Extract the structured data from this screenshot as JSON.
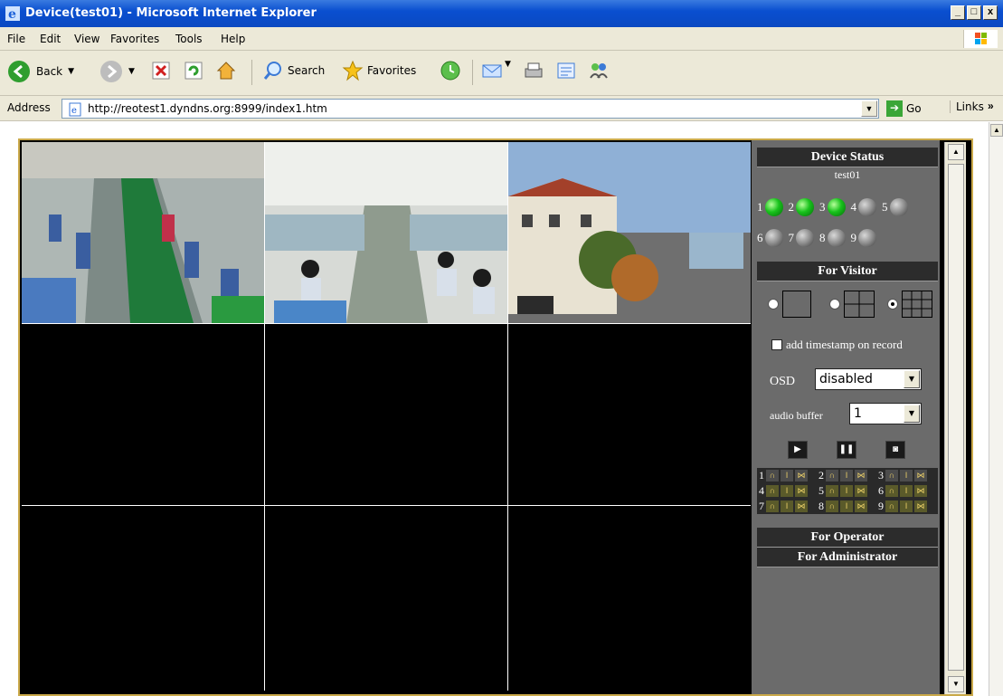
{
  "window": {
    "title": "Device(test01) - Microsoft Internet Explorer",
    "buttons": [
      "_",
      "□",
      "x"
    ]
  },
  "menu": [
    "File",
    "Edit",
    "View",
    "Favorites",
    "Tools",
    "Help"
  ],
  "toolbar": {
    "back_label": "Back",
    "search_label": "Search",
    "favorites_label": "Favorites"
  },
  "address": {
    "label": "Address",
    "url": "http://reotest1.dyndns.org:8999/index1.htm",
    "go_label": "Go",
    "links_label": "Links"
  },
  "device_status": {
    "header": "Device Status",
    "device_name": "test01",
    "leds": [
      {
        "num": "1",
        "state": "on"
      },
      {
        "num": "2",
        "state": "on"
      },
      {
        "num": "3",
        "state": "on"
      },
      {
        "num": "4",
        "state": "off"
      },
      {
        "num": "5",
        "state": "off"
      },
      {
        "num": "6",
        "state": "off"
      },
      {
        "num": "7",
        "state": "off"
      },
      {
        "num": "8",
        "state": "off"
      },
      {
        "num": "9",
        "state": "off"
      }
    ]
  },
  "visitor": {
    "header": "For Visitor",
    "layouts": [
      "1x1",
      "2x2",
      "3x3"
    ],
    "selected_layout": "3x3",
    "timestamp_label": "add timestamp on record",
    "timestamp_checked": false,
    "osd_label": "OSD",
    "osd_value": "disabled",
    "audio_buffer_label": "audio buffer",
    "audio_buffer_value": "1",
    "channels": [
      "1",
      "2",
      "3",
      "4",
      "5",
      "6",
      "7",
      "8",
      "9"
    ]
  },
  "operator": {
    "header": "For Operator"
  },
  "administrator": {
    "header": "For Administrator"
  },
  "colors": {
    "titlebar": "#0a4fd0",
    "chrome": "#ece9d8",
    "panel": "#6b6b6b",
    "panel_header": "#2c2c2c",
    "led_on": "#18c21c",
    "frame_border": "#caa94a"
  }
}
